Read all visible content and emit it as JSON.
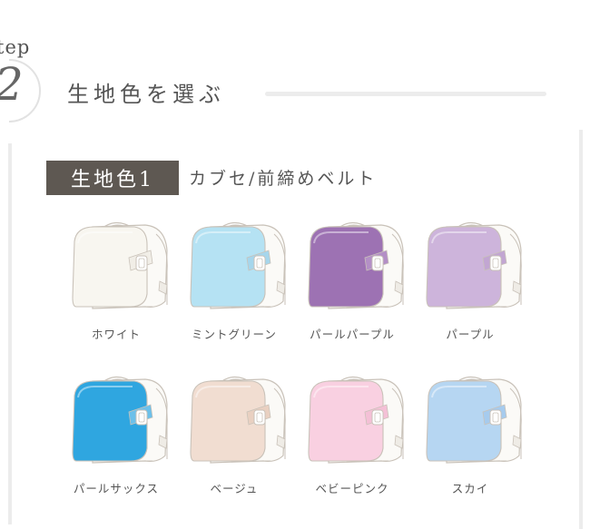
{
  "step": {
    "word": "tep",
    "number": "2",
    "title": "生地色を選ぶ"
  },
  "section": {
    "badge": "生地色1",
    "description": "カブセ/前締めベルト"
  },
  "colors": {
    "line": "#c9c2b9",
    "body": "#fbfaf7",
    "strap": "#efece6"
  },
  "swatches": [
    {
      "label": "ホワイト",
      "flap": "#f8f6f0",
      "belt": "#f1eee7"
    },
    {
      "label": "ミントグリーン",
      "flap": "#b5e2f3",
      "belt": "#a6d6ec"
    },
    {
      "label": "パールパープル",
      "flap": "#9d72b3",
      "belt": "#b48fc6"
    },
    {
      "label": "パープル",
      "flap": "#cdb4db",
      "belt": "#c2a6d2"
    },
    {
      "label": "パールサックス",
      "flap": "#2fa6e0",
      "belt": "#6cc0ea"
    },
    {
      "label": "ベージュ",
      "flap": "#f1ddd1",
      "belt": "#e9d0c1"
    },
    {
      "label": "ベビーピンク",
      "flap": "#f9d0e1",
      "belt": "#f4c0d6"
    },
    {
      "label": "スカイ",
      "flap": "#b6d6f2",
      "belt": "#a6cbee"
    }
  ]
}
